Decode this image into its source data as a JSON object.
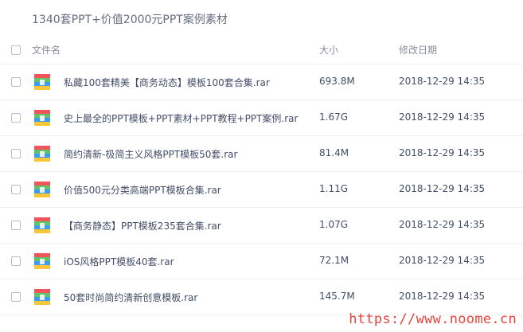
{
  "folder": {
    "title": "1340套PPT+价值2000元PPT案例素材"
  },
  "table": {
    "headers": {
      "name": "文件名",
      "size": "大小",
      "modified": "修改日期"
    },
    "rows": [
      {
        "name": "私藏100套精美【商务动态】模板100套合集.rar",
        "size": "693.8M",
        "modified": "2018-12-29 14:35",
        "icon": "archive-icon"
      },
      {
        "name": "史上最全的PPT模板+PPT素材+PPT教程+PPT案例.rar",
        "size": "1.67G",
        "modified": "2018-12-29 14:35",
        "icon": "archive-icon"
      },
      {
        "name": "简约清新-极简主义风格PPT模板50套.rar",
        "size": "81.4M",
        "modified": "2018-12-29 14:35",
        "icon": "archive-icon"
      },
      {
        "name": "价值500元分类高端PPT模板合集.rar",
        "size": "1.11G",
        "modified": "2018-12-29 14:35",
        "icon": "archive-icon"
      },
      {
        "name": "【商务静态】PPT模板235套合集.rar",
        "size": "1.07G",
        "modified": "2018-12-29 14:35",
        "icon": "archive-icon"
      },
      {
        "name": "iOS风格PPT模板40套.rar",
        "size": "72.1M",
        "modified": "2018-12-29 14:35",
        "icon": "archive-icon"
      },
      {
        "name": "50套时尚简约清新创意模板.rar",
        "size": "145.7M",
        "modified": "2018-12-29 14:35",
        "icon": "archive-icon"
      }
    ]
  },
  "watermark": {
    "text": "https://www.noome.cn"
  },
  "colors": {
    "text_primary": "#424e67",
    "text_secondary": "#888e9b",
    "divider": "#f0f1f3",
    "watermark": "#e8443c",
    "icon_red": "#f2545b",
    "icon_green": "#5fc368",
    "icon_blue": "#3e9bf3",
    "icon_yellow": "#f8c636"
  }
}
